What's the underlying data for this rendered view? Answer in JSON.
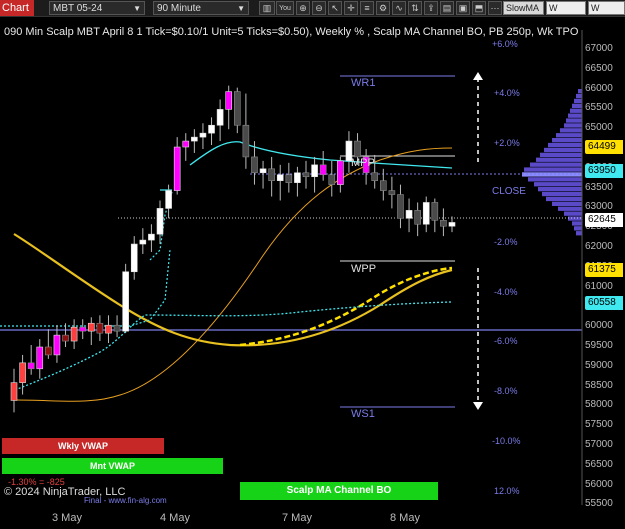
{
  "toolbar": {
    "chart_button": "Chart",
    "instrument": "MBT 05-24",
    "interval": "90 Minute",
    "tools_label": "You",
    "indicators": [
      "SlowMA",
      "W VWAP",
      "W WEEKLY"
    ]
  },
  "title": "090 Min Scalp MBT April 8 1 Tick=$0.10/1 Unit=5 Ticks=$0.50), Weekly % , Scalp MA Channel BO, PB 250p, Wk TPO",
  "price_axis": [
    "67000",
    "66500",
    "66000",
    "65500",
    "65000",
    "64500",
    "64000",
    "63500",
    "63000",
    "62500",
    "62000",
    "61500",
    "61000",
    "60500",
    "60000",
    "59500",
    "59000",
    "58500",
    "58000",
    "57500",
    "57000",
    "56500",
    "56000",
    "55500"
  ],
  "price_tags": [
    {
      "label": "64499",
      "bg": "#ffe000"
    },
    {
      "label": "63950",
      "bg": "#40e8ef"
    },
    {
      "label": "62645",
      "bg": "#ffffff"
    },
    {
      "label": "61375",
      "bg": "#ffe000"
    },
    {
      "label": "60558",
      "bg": "#40e8ef"
    }
  ],
  "percent_labels": [
    "+6.0%",
    "+4.0%",
    "+2.0%",
    "-2.0%",
    "-4.0%",
    "-6.0%",
    "-8.0%",
    "-10.0%",
    "12.0%"
  ],
  "close_label": "CLOSE",
  "levels": {
    "wr1": "WR1",
    "wpp": "WPP",
    "ws1": "WS1",
    "mpp": "MPP"
  },
  "banners": {
    "wkly_vwap": "Wkly VWAP",
    "mnt_vwap": "Mnt VWAP",
    "scalp_ma": "Scalp MA Channel BO"
  },
  "footer": {
    "pct": "-1.30% = -825",
    "copyright": "© 2024 NinjaTrader, LLC",
    "site": "Final - www.fin-alg.com"
  },
  "x_axis": [
    "3 May",
    "4 May",
    "7 May",
    "8 May"
  ],
  "colors": {
    "up": "#ffffff",
    "down": "#444444",
    "highlight": "#ff00ff",
    "cyan": "#40e8ef",
    "yellow": "#ffe000",
    "orange": "#e8a020",
    "slow_ma": "#c8a030",
    "level": "#7b7bea",
    "red": "#c62828",
    "green": "#17d317"
  },
  "chart_data": {
    "type": "candlestick",
    "x_labels": [
      "3 May",
      "4 May",
      "7 May",
      "8 May"
    ],
    "ylim": [
      55250,
      67250
    ],
    "last_price": 62645,
    "candles": [
      {
        "o": 58150,
        "h": 58950,
        "l": 57850,
        "c": 58600
      },
      {
        "o": 58600,
        "h": 59300,
        "l": 58300,
        "c": 59100
      },
      {
        "o": 59100,
        "h": 59550,
        "l": 58800,
        "c": 58950
      },
      {
        "o": 58950,
        "h": 59700,
        "l": 58700,
        "c": 59500
      },
      {
        "o": 59500,
        "h": 59950,
        "l": 59200,
        "c": 59300
      },
      {
        "o": 59300,
        "h": 60050,
        "l": 59100,
        "c": 59800
      },
      {
        "o": 59800,
        "h": 60100,
        "l": 59500,
        "c": 59650
      },
      {
        "o": 59650,
        "h": 60200,
        "l": 59450,
        "c": 60000
      },
      {
        "o": 60000,
        "h": 60200,
        "l": 59700,
        "c": 59900
      },
      {
        "o": 59900,
        "h": 60250,
        "l": 59550,
        "c": 60100
      },
      {
        "o": 60100,
        "h": 60300,
        "l": 59650,
        "c": 59850
      },
      {
        "o": 59850,
        "h": 60300,
        "l": 59600,
        "c": 60050
      },
      {
        "o": 60050,
        "h": 60300,
        "l": 59750,
        "c": 59900
      },
      {
        "o": 59900,
        "h": 61600,
        "l": 59850,
        "c": 61400
      },
      {
        "o": 61400,
        "h": 62300,
        "l": 61200,
        "c": 62100
      },
      {
        "o": 62100,
        "h": 62500,
        "l": 61850,
        "c": 62200
      },
      {
        "o": 62200,
        "h": 62600,
        "l": 61900,
        "c": 62350
      },
      {
        "o": 62350,
        "h": 63200,
        "l": 62100,
        "c": 63000
      },
      {
        "o": 63000,
        "h": 63600,
        "l": 62750,
        "c": 63450
      },
      {
        "o": 63450,
        "h": 64800,
        "l": 63350,
        "c": 64550
      },
      {
        "o": 64550,
        "h": 64900,
        "l": 64200,
        "c": 64700
      },
      {
        "o": 64700,
        "h": 65000,
        "l": 64400,
        "c": 64800
      },
      {
        "o": 64800,
        "h": 65150,
        "l": 64500,
        "c": 64900
      },
      {
        "o": 64900,
        "h": 65300,
        "l": 64600,
        "c": 65100
      },
      {
        "o": 65100,
        "h": 65750,
        "l": 64700,
        "c": 65500
      },
      {
        "o": 65500,
        "h": 66100,
        "l": 65000,
        "c": 65950
      },
      {
        "o": 65950,
        "h": 66050,
        "l": 64900,
        "c": 65100
      },
      {
        "o": 65100,
        "h": 65900,
        "l": 64000,
        "c": 64300
      },
      {
        "o": 64300,
        "h": 64700,
        "l": 63600,
        "c": 63900
      },
      {
        "o": 63900,
        "h": 64200,
        "l": 63500,
        "c": 64000
      },
      {
        "o": 64000,
        "h": 64300,
        "l": 63300,
        "c": 63700
      },
      {
        "o": 63700,
        "h": 64100,
        "l": 63200,
        "c": 63850
      },
      {
        "o": 63850,
        "h": 64150,
        "l": 63400,
        "c": 63650
      },
      {
        "o": 63650,
        "h": 64050,
        "l": 63300,
        "c": 63900
      },
      {
        "o": 63900,
        "h": 64200,
        "l": 63500,
        "c": 63800
      },
      {
        "o": 63800,
        "h": 64300,
        "l": 63400,
        "c": 64100
      },
      {
        "o": 64100,
        "h": 64450,
        "l": 63700,
        "c": 63850
      },
      {
        "o": 63850,
        "h": 64200,
        "l": 63300,
        "c": 63600
      },
      {
        "o": 63600,
        "h": 64300,
        "l": 63400,
        "c": 64200
      },
      {
        "o": 64200,
        "h": 64950,
        "l": 63900,
        "c": 64700
      },
      {
        "o": 64700,
        "h": 64900,
        "l": 64100,
        "c": 64300
      },
      {
        "o": 64300,
        "h": 64500,
        "l": 63600,
        "c": 63900
      },
      {
        "o": 63900,
        "h": 64350,
        "l": 63500,
        "c": 63700
      },
      {
        "o": 63700,
        "h": 64000,
        "l": 63200,
        "c": 63450
      },
      {
        "o": 63450,
        "h": 63800,
        "l": 63000,
        "c": 63350
      },
      {
        "o": 63350,
        "h": 63600,
        "l": 62500,
        "c": 62750
      },
      {
        "o": 62750,
        "h": 63250,
        "l": 62400,
        "c": 62950
      },
      {
        "o": 62950,
        "h": 63150,
        "l": 62300,
        "c": 62600
      },
      {
        "o": 62600,
        "h": 63300,
        "l": 62400,
        "c": 63150
      },
      {
        "o": 63150,
        "h": 63250,
        "l": 62400,
        "c": 62700
      },
      {
        "o": 62700,
        "h": 63000,
        "l": 62300,
        "c": 62550
      },
      {
        "o": 62550,
        "h": 62800,
        "l": 62400,
        "c": 62645
      }
    ]
  }
}
